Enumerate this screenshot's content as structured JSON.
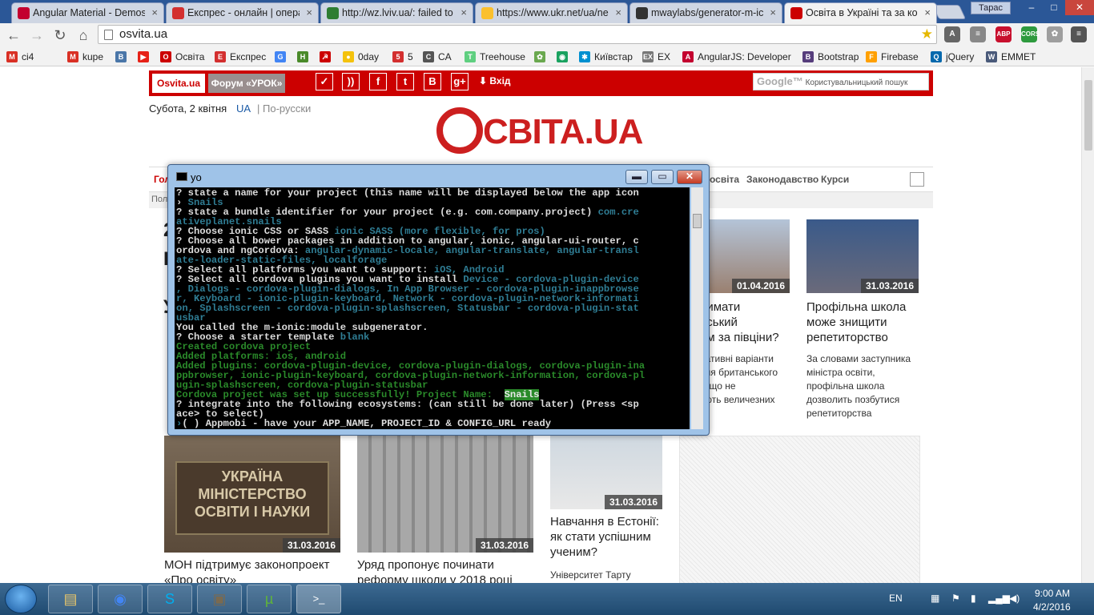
{
  "browser": {
    "tabs": [
      {
        "title": "Angular Material - Demos",
        "color": "#c3002f"
      },
      {
        "title": "Експрес - онлайн | опера",
        "color": "#d32f2f"
      },
      {
        "title": "http://wz.lviv.ua/: failed to",
        "color": "#2e7d32"
      },
      {
        "title": "https://www.ukr.net/ua/ne",
        "color": "#fbc02d"
      },
      {
        "title": "mwaylabs/generator-m-ic",
        "color": "#333333"
      },
      {
        "title": "Освіта в Україні та за кор",
        "color": "#cc0000"
      }
    ],
    "tab_close": "×",
    "user": "Тарас",
    "win_min": "–",
    "win_max": "□",
    "win_close": "✕",
    "back": "←",
    "forward": "→",
    "reload": "↻",
    "home": "⌂",
    "address": "osvita.ua",
    "star": "★",
    "extensions": [
      {
        "label": "A",
        "color": "#666666"
      },
      {
        "label": "≡",
        "color": "#888888"
      },
      {
        "label": "ABP",
        "color": "#c8102e"
      },
      {
        "label": "CORS",
        "color": "#2e9a3e"
      },
      {
        "label": "✿",
        "color": "#9e9e9e"
      },
      {
        "label": "≡",
        "color": "#555555"
      }
    ]
  },
  "bookmarks": [
    {
      "label": "ci4",
      "icon": "M",
      "color": "#d93025"
    },
    {
      "label": "kupe",
      "icon": "M",
      "color": "#d93025"
    },
    {
      "label": "",
      "icon": "B",
      "color": "#4a76a8"
    },
    {
      "label": "",
      "icon": "▶",
      "color": "#e62117"
    },
    {
      "label": "Освіта",
      "icon": "О",
      "color": "#cc0000"
    },
    {
      "label": "Експрес",
      "icon": "E",
      "color": "#d32f2f"
    },
    {
      "label": "",
      "icon": "G",
      "color": "#4285f4"
    },
    {
      "label": "",
      "icon": "H",
      "color": "#4a8a2a"
    },
    {
      "label": "",
      "icon": "☭",
      "color": "#cc0000"
    },
    {
      "label": "0day",
      "icon": "●",
      "color": "#f4c20d"
    },
    {
      "label": "5",
      "icon": "5",
      "color": "#d32f2f"
    },
    {
      "label": "CA",
      "icon": "C",
      "color": "#555555"
    },
    {
      "label": "Treehouse",
      "icon": "T",
      "color": "#5fcf80"
    },
    {
      "label": "",
      "icon": "✿",
      "color": "#6aa84f"
    },
    {
      "label": "",
      "icon": "◉",
      "color": "#1aa260"
    },
    {
      "label": "Київстар",
      "icon": "✱",
      "color": "#0090d0"
    },
    {
      "label": "EX",
      "icon": "EX",
      "color": "#777777"
    },
    {
      "label": "AngularJS: Developer",
      "icon": "A",
      "color": "#c3002f"
    },
    {
      "label": "Bootstrap",
      "icon": "B",
      "color": "#563d7c"
    },
    {
      "label": "Firebase",
      "icon": "F",
      "color": "#ffa000"
    },
    {
      "label": "jQuery",
      "icon": "Q",
      "color": "#0769ad"
    },
    {
      "label": "EMMET",
      "icon": "W",
      "color": "#4a5a7a"
    }
  ],
  "site": {
    "tab_site": "Osvita.ua",
    "tab_forum": "Форум «УРОК»",
    "social": [
      "✓",
      "))",
      "f",
      "t",
      "B",
      "g+"
    ],
    "login_arrow": "⬇",
    "login": "Вхід",
    "google_logo": "Google™",
    "google_placeholder": "Користувальницький пошук",
    "date": "Субота, 2 квітня",
    "lang_ua": "UA",
    "lang_ru": "| По-русски",
    "logo_text": "СВІТА.UA",
    "nav": [
      "Гол",
      "освіта",
      "Законодавство",
      "Курси"
    ],
    "subnav": "Пол",
    "left_fragments": [
      "2",
      "I",
      "У"
    ],
    "cards": [
      {
        "date": "01.04.2016",
        "title": "оимати\nнський\nом за півціни?",
        "text": "нативні варіанти\nння британського\nу, що не\nують величезних"
      },
      {
        "date": "31.03.2016",
        "title": "Профільна школа\nможе знищити\nрепетиторство",
        "text": "За словами заступника\nміністра освіти,\nпрофільна школа\nдозволить позбутися\nрепетиторства"
      },
      {
        "date": "31.03.2016",
        "title": "МОН підтримує законопроект\n«Про освіту»",
        "text": "",
        "plaque": "УКРАЇНА\nМІНІСТЕРСТВО\nОСВІТИ І НАУКИ"
      },
      {
        "date": "31.03.2016",
        "title": "Уряд пропонує починати\nреформу школи у 2018 році",
        "text": ""
      },
      {
        "date": "31.03.2016",
        "title": "Навчання в Естонії:\nяк стати успішним\nученим?",
        "text": "Університет Тарту"
      }
    ]
  },
  "console": {
    "title": "yo",
    "min": "▬",
    "max": "▭",
    "close": "✕",
    "lines": [
      [
        [
          "w",
          "? state a name for your project (this name will be displayed below the app icon"
        ]
      ],
      [
        [
          "w",
          "› "
        ],
        [
          "c",
          "Snails"
        ]
      ],
      [
        [
          "w",
          "? state a bundle identifier for your project (e.g. com.company.project) "
        ],
        [
          "c",
          "com.cre"
        ]
      ],
      [
        [
          "c",
          "ativeplanet.snails"
        ]
      ],
      [
        [
          "w",
          "? Choose ionic CSS or SASS "
        ],
        [
          "c",
          "ionic SASS (more flexible, for pros)"
        ]
      ],
      [
        [
          "w",
          "? Choose all bower packages in addition to angular, ionic, angular-ui-router, c"
        ]
      ],
      [
        [
          "w",
          "ordova and ngCordova: "
        ],
        [
          "c",
          "angular-dynamic-locale, angular-translate, angular-transl"
        ]
      ],
      [
        [
          "c",
          "ate-loader-static-files, localforage"
        ]
      ],
      [
        [
          "w",
          "? Select all platforms you want to support: "
        ],
        [
          "c",
          "iOS, Android"
        ]
      ],
      [
        [
          "w",
          "? Select all cordova plugins you want to install "
        ],
        [
          "c",
          "Device - cordova-plugin-device"
        ]
      ],
      [
        [
          "c",
          ", Dialogs - cordova-plugin-dialogs, In App Browser - cordova-plugin-inappbrowse"
        ]
      ],
      [
        [
          "c",
          "r, Keyboard - ionic-plugin-keyboard, Network - cordova-plugin-network-informati"
        ]
      ],
      [
        [
          "c",
          "on, Splashscreen - cordova-plugin-splashscreen, Statusbar - cordova-plugin-stat"
        ]
      ],
      [
        [
          "c",
          "usbar"
        ]
      ],
      [
        [
          "w",
          "You called the m-ionic:module subgenerator."
        ]
      ],
      [
        [
          "w",
          "? Choose a starter template "
        ],
        [
          "c",
          "blank"
        ]
      ],
      [
        [
          "g",
          "Created cordova project"
        ]
      ],
      [
        [
          "g",
          "Added platforms: ios, android"
        ]
      ],
      [
        [
          "g",
          "Added plugins: cordova-plugin-device, cordova-plugin-dialogs, cordova-plugin-ina"
        ]
      ],
      [
        [
          "g",
          "ppbrowser, ionic-plugin-keyboard, cordova-plugin-network-information, cordova-pl"
        ]
      ],
      [
        [
          "g",
          "ugin-splashscreen, cordova-plugin-statusbar"
        ]
      ],
      [
        [
          "g",
          "Cordova project was set up successfully! Project Name:  "
        ],
        [
          "hl",
          "Snails"
        ]
      ],
      [
        [
          "w",
          "? integrate into the following ecosystems: (can still be done later) (Press <sp"
        ]
      ],
      [
        [
          "w",
          "ace> to select)"
        ]
      ],
      [
        [
          "c",
          "›"
        ],
        [
          "w",
          "( ) Appmobi - have your APP_NAME, PROJECT_ID & CONFIG_URL ready"
        ]
      ]
    ]
  },
  "taskbar": {
    "apps": [
      "▤",
      "◉",
      "S",
      "▣",
      "µ",
      ">_"
    ],
    "app_colors": [
      "#e8c66a",
      "#4285f4",
      "#00aff0",
      "#7a6a50",
      "#5fb43a",
      "#222222"
    ],
    "lang": "EN",
    "time": "9:00 AM",
    "date": "4/2/2016"
  }
}
